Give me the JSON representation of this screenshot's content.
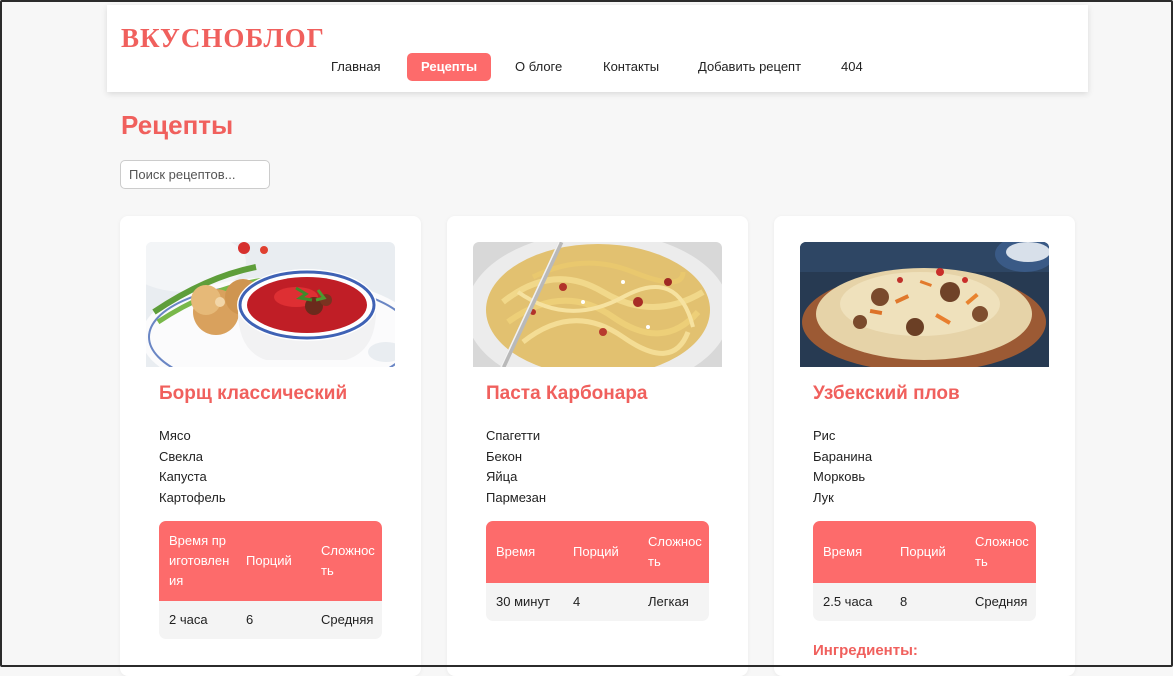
{
  "site": {
    "logo": "ВКУСНОБЛОГ"
  },
  "nav": {
    "items": [
      {
        "label": "Главная",
        "active": false
      },
      {
        "label": "Рецепты",
        "active": true
      },
      {
        "label": "О блоге",
        "active": false
      },
      {
        "label": "Контакты",
        "active": false
      },
      {
        "label": "Добавить рецепт",
        "active": false
      },
      {
        "label": "404",
        "active": false
      }
    ]
  },
  "page": {
    "title": "Рецепты"
  },
  "search": {
    "placeholder": "Поиск рецептов...",
    "value": ""
  },
  "accent_color": "#fd6b6b",
  "title_color": "#f0605d",
  "recipes": [
    {
      "title": "Борщ классический",
      "image_icon": "borscht-photo",
      "ingredients": [
        "Мясо",
        "Свекла",
        "Капуста",
        "Картофель"
      ],
      "table": {
        "headers": [
          "Время приготовления",
          "Порций",
          "Сложность"
        ],
        "values": [
          "2 часа",
          "6",
          "Средняя"
        ]
      }
    },
    {
      "title": "Паста Карбонара",
      "image_icon": "carbonara-photo",
      "ingredients": [
        "Спагетти",
        "Бекон",
        "Яйца",
        "Пармезан"
      ],
      "table": {
        "headers": [
          "Время",
          "Порций",
          "Сложность"
        ],
        "values": [
          "30 минут",
          "4",
          "Легкая"
        ]
      }
    },
    {
      "title": "Узбекский плов",
      "image_icon": "plov-photo",
      "ingredients": [
        "Рис",
        "Баранина",
        "Морковь",
        "Лук"
      ],
      "table": {
        "headers": [
          "Время",
          "Порций",
          "Сложность"
        ],
        "values": [
          "2.5 часа",
          "8",
          "Средняя"
        ]
      },
      "ingredients_heading": "Ингредиенты:"
    }
  ]
}
